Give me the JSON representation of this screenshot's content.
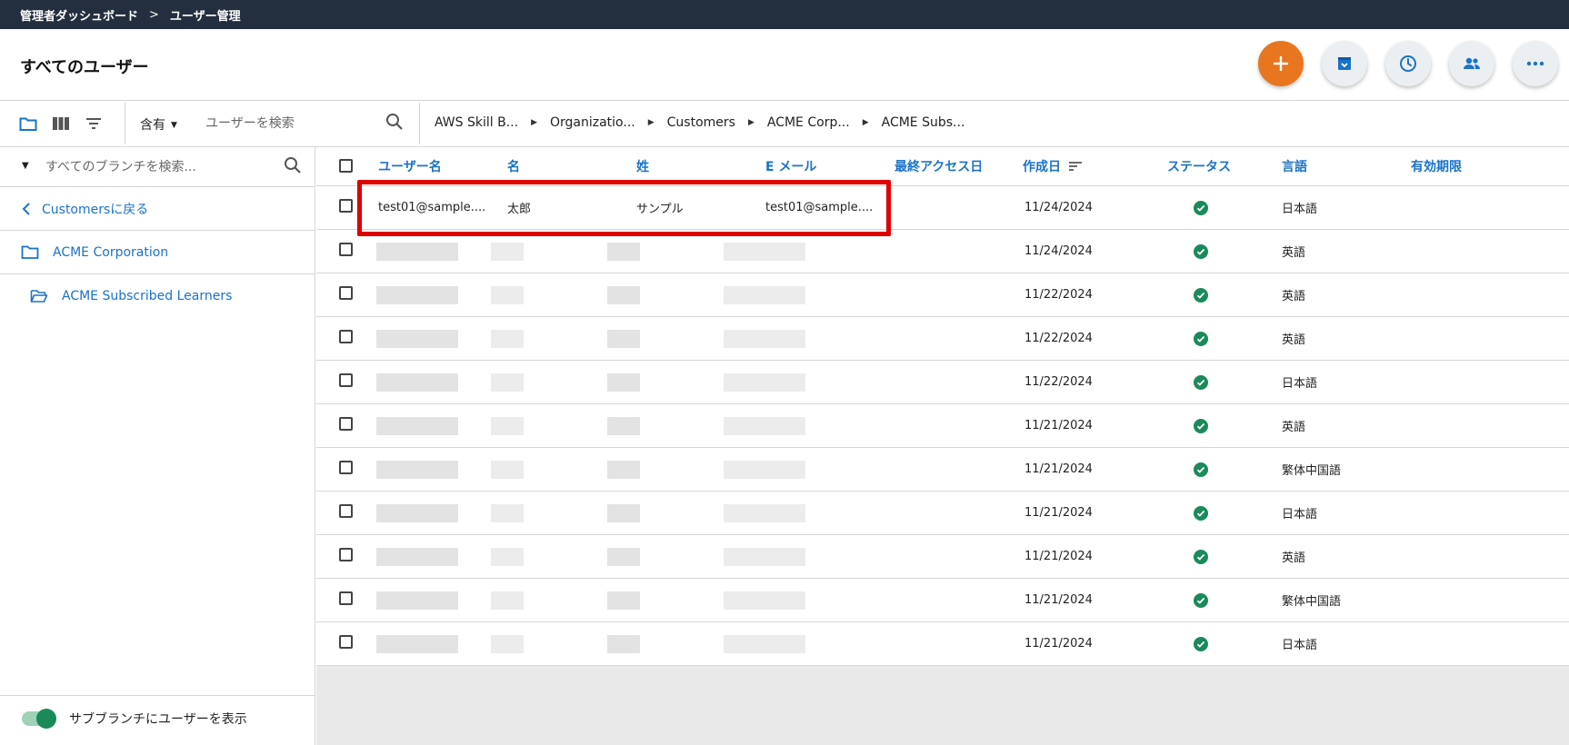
{
  "topbar": {
    "crumb1": "管理者ダッシュボード",
    "sep": ">",
    "crumb2": "ユーザー管理"
  },
  "header": {
    "title": "すべてのユーザー"
  },
  "actions": {
    "add_icon": "plus-icon",
    "archive_icon": "archive-icon",
    "history_icon": "clock-icon",
    "groups_icon": "people-icon",
    "more_icon": "more-icon"
  },
  "toolbar": {
    "filter_mode": "含有",
    "search_placeholder": "ユーザーを検索",
    "breadcrumbs": [
      "AWS Skill B...",
      "Organizatio...",
      "Customers",
      "ACME Corp...",
      "ACME Subs..."
    ]
  },
  "sidebar": {
    "branch_search_placeholder": "すべてのブランチを検索...",
    "back_label": "Customersに戻る",
    "org_label": "ACME Corporation",
    "sub_label": "ACME Subscribed Learners",
    "toggle_label": "サブブランチにユーザーを表示"
  },
  "table": {
    "headers": {
      "username": "ユーザー名",
      "first": "名",
      "last": "姓",
      "email": "E メール",
      "last_access": "最終アクセス日",
      "created": "作成日",
      "status": "ステータス",
      "language": "言語",
      "expiry": "有効期限"
    },
    "rows": [
      {
        "username": "test01@sample....",
        "first": "太郎",
        "last": "サンプル",
        "email": "test01@sample....",
        "created": "11/24/2024",
        "language": "日本語"
      },
      {
        "username": "",
        "first": "",
        "last": "",
        "email": "",
        "created": "11/24/2024",
        "language": "英語"
      },
      {
        "username": "",
        "first": "",
        "last": "",
        "email": "",
        "created": "11/22/2024",
        "language": "英語"
      },
      {
        "username": "",
        "first": "",
        "last": "",
        "email": "",
        "created": "11/22/2024",
        "language": "英語"
      },
      {
        "username": "",
        "first": "",
        "last": "",
        "email": "",
        "created": "11/22/2024",
        "language": "日本語"
      },
      {
        "username": "",
        "first": "",
        "last": "",
        "email": "",
        "created": "11/21/2024",
        "language": "英語"
      },
      {
        "username": "",
        "first": "",
        "last": "",
        "email": "",
        "created": "11/21/2024",
        "language": "繁体中国語"
      },
      {
        "username": "",
        "first": "",
        "last": "",
        "email": "",
        "created": "11/21/2024",
        "language": "日本語"
      },
      {
        "username": "",
        "first": "",
        "last": "",
        "email": "",
        "created": "11/21/2024",
        "language": "英語"
      },
      {
        "username": "",
        "first": "",
        "last": "",
        "email": "",
        "created": "11/21/2024",
        "language": "繁体中国語"
      },
      {
        "username": "",
        "first": "",
        "last": "",
        "email": "",
        "created": "11/21/2024",
        "language": "日本語"
      }
    ]
  },
  "colors": {
    "accent": "#1a73c8",
    "primary_action": "#e8761e",
    "status_ok": "#1b8a5a",
    "highlight": "#e00000",
    "topbar": "#232f3e"
  }
}
